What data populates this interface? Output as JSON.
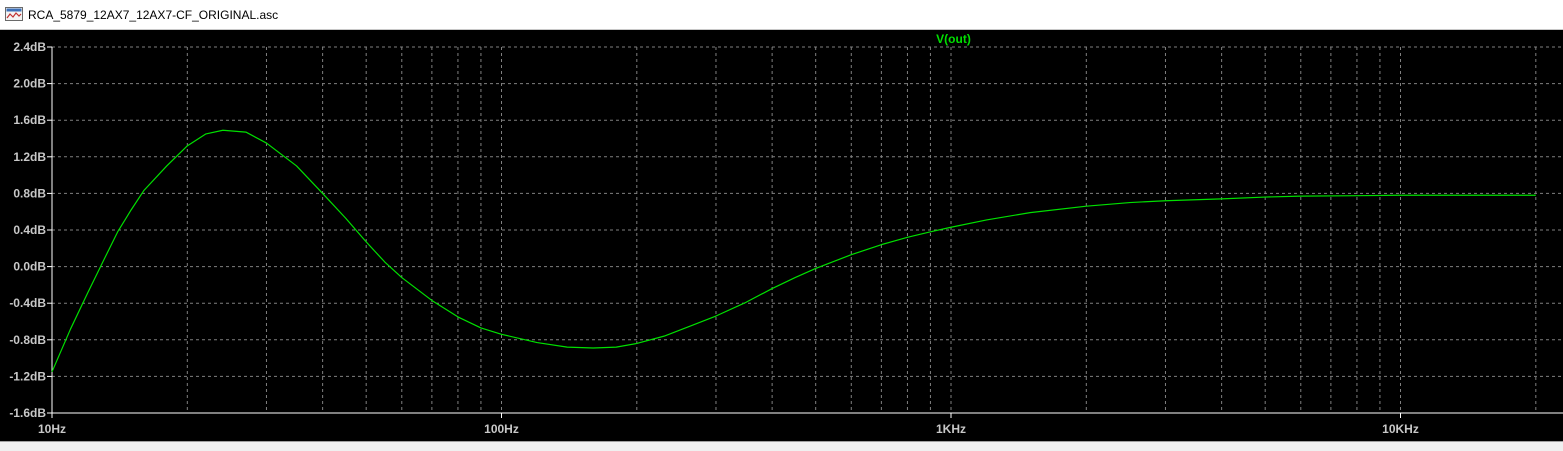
{
  "window": {
    "title": "RCA_5879_12AX7_12AX7-CF_ORIGINAL.asc",
    "icon": "waveform-viewer-icon"
  },
  "colors": {
    "background": "#000000",
    "grid": "#808080",
    "trace": "#00e000",
    "axis_text": "#c8c8c8"
  },
  "chart_data": {
    "type": "line",
    "title": "V(out)",
    "xlabel": "",
    "ylabel": "",
    "xscale": "log",
    "xlim": [
      10,
      20000
    ],
    "ylim": [
      -1.6,
      2.4
    ],
    "grid": true,
    "x_ticks": [
      {
        "value": 10,
        "label": "10Hz"
      },
      {
        "value": 100,
        "label": "100Hz"
      },
      {
        "value": 1000,
        "label": "1KHz"
      },
      {
        "value": 10000,
        "label": "10KHz"
      }
    ],
    "y_ticks": [
      {
        "value": 2.4,
        "label": "2.4dB"
      },
      {
        "value": 2.0,
        "label": "2.0dB"
      },
      {
        "value": 1.6,
        "label": "1.6dB"
      },
      {
        "value": 1.2,
        "label": "1.2dB"
      },
      {
        "value": 0.8,
        "label": "0.8dB"
      },
      {
        "value": 0.4,
        "label": "0.4dB"
      },
      {
        "value": 0.0,
        "label": "0.0dB"
      },
      {
        "value": -0.4,
        "label": "-0.4dB"
      },
      {
        "value": -0.8,
        "label": "-0.8dB"
      },
      {
        "value": -1.2,
        "label": "-1.2dB"
      },
      {
        "value": -1.6,
        "label": "-1.6dB"
      }
    ],
    "series": [
      {
        "name": "V(out)",
        "x": [
          10,
          11,
          12,
          13,
          14,
          15,
          16,
          18,
          20,
          22,
          24,
          27,
          30,
          35,
          40,
          45,
          50,
          55,
          60,
          70,
          80,
          90,
          100,
          120,
          140,
          160,
          180,
          200,
          230,
          260,
          300,
          350,
          400,
          450,
          500,
          600,
          700,
          800,
          900,
          1000,
          1200,
          1500,
          2000,
          2500,
          3000,
          4000,
          5000,
          6000,
          8000,
          10000,
          15000,
          20000
        ],
        "y": [
          -1.15,
          -0.68,
          -0.29,
          0.06,
          0.38,
          0.62,
          0.83,
          1.1,
          1.32,
          1.45,
          1.49,
          1.47,
          1.35,
          1.1,
          0.8,
          0.53,
          0.27,
          0.05,
          -0.12,
          -0.37,
          -0.55,
          -0.67,
          -0.74,
          -0.83,
          -0.88,
          -0.89,
          -0.88,
          -0.84,
          -0.76,
          -0.66,
          -0.54,
          -0.39,
          -0.24,
          -0.12,
          -0.02,
          0.13,
          0.24,
          0.32,
          0.38,
          0.43,
          0.51,
          0.59,
          0.66,
          0.7,
          0.72,
          0.74,
          0.76,
          0.77,
          0.775,
          0.78,
          0.78,
          0.78
        ]
      }
    ]
  }
}
